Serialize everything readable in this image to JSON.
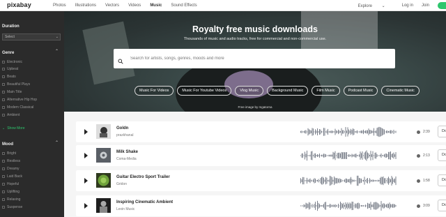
{
  "header": {
    "logo": "pixabay",
    "nav": [
      "Photos",
      "Illustrations",
      "Vectors",
      "Videos",
      "Music",
      "Sound Effects"
    ],
    "active_nav": "Music",
    "explore": "Explore",
    "login": "Log in",
    "join": "Join"
  },
  "sidebar": {
    "duration_heading": "Duration",
    "duration_select": "Select",
    "genre_heading": "Genre",
    "genres": [
      "Electronic",
      "Upbeat",
      "Beats",
      "Beautiful Plays",
      "Main Title",
      "Alternative Hip Hop",
      "Modern Classical",
      "Ambient"
    ],
    "show_more": "Show More",
    "mood_heading": "Mood",
    "moods": [
      "Bright",
      "Restless",
      "Dreamy",
      "Laid Back",
      "Hopeful",
      "Uplifting",
      "Relaxing",
      "Suspense"
    ]
  },
  "hero": {
    "title": "Royalty free music downloads",
    "subtitle": "Thousands of music and audio tracks, free for commercial and non-commercial use.",
    "search_placeholder": "Search for artists, songs, genres, moods and more",
    "chips": [
      "Music For Videos",
      "Music For Youtube Videos",
      "Vlog Music",
      "Background Music",
      "Film Music",
      "Podcast Music",
      "Cinematic Music"
    ],
    "credit": "Free image by mgatorna"
  },
  "tracks": [
    {
      "title": "Goldn",
      "artist": "prazkhanal",
      "duration": "2:39",
      "download": "Do"
    },
    {
      "title": "Milk Shake",
      "artist": "Coma-Media",
      "duration": "2:13",
      "download": "Do"
    },
    {
      "title": "Guitar Electro Sport Trailer",
      "artist": "Gridon",
      "duration": "1:58",
      "download": "Do"
    },
    {
      "title": "Inspiring Cinematic Ambient",
      "artist": "Lexin Music",
      "duration": "3:09",
      "download": "Do"
    }
  ],
  "colors": {
    "accent": "#2ec66d",
    "sidebar_bg": "#2b2b2b",
    "page_bg": "#f5f5f5",
    "waveform": "#7a7f8a"
  }
}
